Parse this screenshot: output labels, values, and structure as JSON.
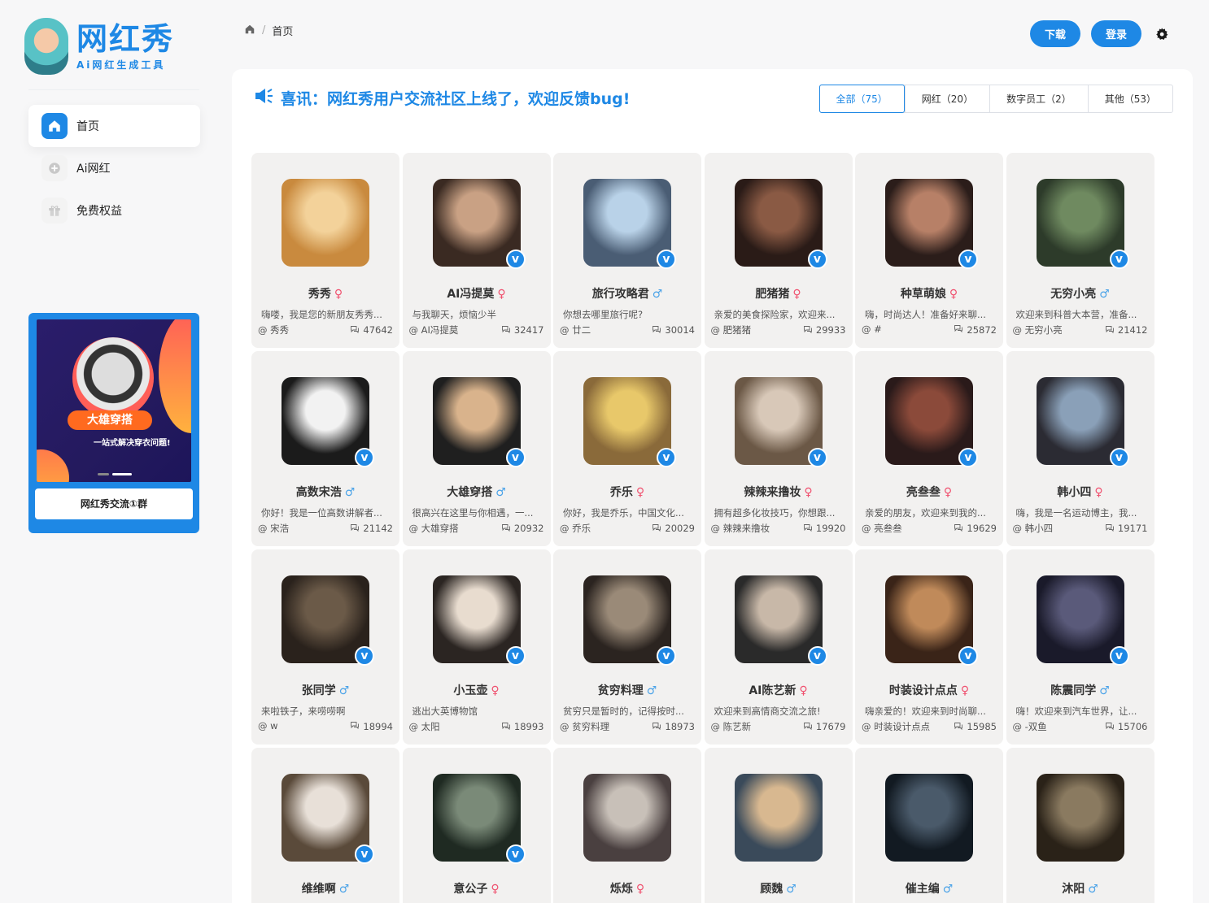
{
  "brand": {
    "title": "网红秀",
    "subtitle": "Ai网红生成工具"
  },
  "nav": [
    {
      "label": "首页",
      "icon": "home-icon",
      "active": true
    },
    {
      "label": "Ai网红",
      "icon": "plus-circle-icon",
      "active": false
    },
    {
      "label": "免费权益",
      "icon": "gift-icon",
      "active": false
    }
  ],
  "promo": {
    "tag": "大雄穿搭",
    "slogan": "一站式解决穿衣问题!",
    "button": "网红秀交流①群"
  },
  "breadcrumb": {
    "home": "首页"
  },
  "actions": {
    "download": "下载",
    "login": "登录"
  },
  "notice": "喜讯：网红秀用户交流社区上线了，欢迎反馈bug!",
  "filters": [
    {
      "label": "全部（75）",
      "active": true
    },
    {
      "label": "网红（20）",
      "active": false
    },
    {
      "label": "数字员工（2）",
      "active": false
    },
    {
      "label": "其他（53）",
      "active": false
    }
  ],
  "colors": {
    "accent": "#1e88e5",
    "female": "#f0506e",
    "male": "#4ba3e8",
    "card": "#f2f1f0"
  },
  "cards": [
    {
      "name": "秀秀",
      "gender": "f",
      "verified": false,
      "desc": "嗨喽，我是您的新朋友秀秀...",
      "author": "秀秀",
      "count": "47642",
      "g": [
        "#f3d29a",
        "#c98a3e"
      ]
    },
    {
      "name": "AI冯提莫",
      "gender": "f",
      "verified": true,
      "desc": "与我聊天，烦恼少半",
      "author": "AI冯提莫",
      "count": "32417",
      "g": [
        "#c9a184",
        "#3a2a22"
      ]
    },
    {
      "name": "旅行攻略君",
      "gender": "m",
      "verified": true,
      "desc": "你想去哪里旅行呢?",
      "author": "廿二",
      "count": "30014",
      "g": [
        "#b9d2e8",
        "#4a5d74"
      ]
    },
    {
      "name": "肥猪猪",
      "gender": "f",
      "verified": true,
      "desc": "亲爱的美食探险家，欢迎来...",
      "author": "肥猪猪",
      "count": "29933",
      "g": [
        "#8a5a44",
        "#2a1b17"
      ]
    },
    {
      "name": "种草萌娘",
      "gender": "f",
      "verified": true,
      "desc": "嗨，时尚达人！准备好来聊...",
      "author": "#",
      "count": "25872",
      "g": [
        "#b78067",
        "#2b1d1a"
      ]
    },
    {
      "name": "无穷小亮",
      "gender": "m",
      "verified": true,
      "desc": "欢迎来到科普大本营，准备...",
      "author": "无穷小亮",
      "count": "21412",
      "g": [
        "#6f8a60",
        "#2d3b2a"
      ]
    },
    {
      "name": "高数宋浩",
      "gender": "m",
      "verified": true,
      "desc": "你好！我是一位高数讲解者...",
      "author": "宋浩",
      "count": "21142",
      "g": [
        "#f2f2f2",
        "#1b1b1b"
      ]
    },
    {
      "name": "大雄穿搭",
      "gender": "m",
      "verified": true,
      "desc": "很高兴在这里与你相遇，一...",
      "author": "大雄穿搭",
      "count": "20932",
      "g": [
        "#d9b38c",
        "#1f1f1f"
      ]
    },
    {
      "name": "乔乐",
      "gender": "f",
      "verified": true,
      "desc": "你好，我是乔乐，中国文化...",
      "author": "乔乐",
      "count": "20029",
      "g": [
        "#e8c86a",
        "#8a6a3a"
      ]
    },
    {
      "name": "辣辣来撸妆",
      "gender": "f",
      "verified": true,
      "desc": "拥有超多化妆技巧，你想跟...",
      "author": "辣辣来撸妆",
      "count": "19920",
      "g": [
        "#d8c8b8",
        "#6b5846"
      ]
    },
    {
      "name": "亮叁叁",
      "gender": "f",
      "verified": true,
      "desc": "亲爱的朋友，欢迎来到我的...",
      "author": "亮叁叁",
      "count": "19629",
      "g": [
        "#8b4a3a",
        "#2a1a1a"
      ]
    },
    {
      "name": "韩小四",
      "gender": "f",
      "verified": true,
      "desc": "嗨，我是一名运动博主，我...",
      "author": "韩小四",
      "count": "19171",
      "g": [
        "#8aa0b8",
        "#2b2b33"
      ]
    },
    {
      "name": "张同学",
      "gender": "m",
      "verified": true,
      "desc": "来啦铁子，来唠唠啊",
      "author": "w",
      "count": "18994",
      "g": [
        "#6b5a48",
        "#2a221c"
      ]
    },
    {
      "name": "小玉壶",
      "gender": "f",
      "verified": true,
      "desc": "逃出大英博物馆",
      "author": "太阳",
      "count": "18993",
      "g": [
        "#e8dccf",
        "#2b2522"
      ]
    },
    {
      "name": "贫穷料理",
      "gender": "m",
      "verified": true,
      "desc": "贫穷只是暂时的，记得按时...",
      "author": "贫穷料理",
      "count": "18973",
      "g": [
        "#9a8a78",
        "#2b2420"
      ]
    },
    {
      "name": "AI陈艺新",
      "gender": "f",
      "verified": true,
      "desc": "欢迎来到高情商交流之旅!",
      "author": "陈艺新",
      "count": "17679",
      "g": [
        "#c8b8a8",
        "#2a2a2a"
      ]
    },
    {
      "name": "时装设计点点",
      "gender": "f",
      "verified": true,
      "desc": "嗨亲爱的！欢迎来到时尚聊...",
      "author": "时装设计点点",
      "count": "15985",
      "g": [
        "#c08a5a",
        "#3a2418"
      ]
    },
    {
      "name": "陈震同学",
      "gender": "m",
      "verified": true,
      "desc": "嗨！欢迎来到汽车世界，让...",
      "author": "-双鱼",
      "count": "15706",
      "g": [
        "#5a5a7a",
        "#1a1a2a"
      ]
    },
    {
      "name": "维维啊",
      "gender": "m",
      "verified": true,
      "desc": "",
      "author": "",
      "count": "",
      "g": [
        "#e8e0d8",
        "#5a4a3a"
      ]
    },
    {
      "name": "意公子",
      "gender": "f",
      "verified": true,
      "desc": "",
      "author": "",
      "count": "",
      "g": [
        "#7a8a78",
        "#1f2a22"
      ]
    },
    {
      "name": "烁烁",
      "gender": "f",
      "verified": false,
      "desc": "",
      "author": "",
      "count": "",
      "g": [
        "#c8c0b8",
        "#4a4040"
      ]
    },
    {
      "name": "顾魏",
      "gender": "m",
      "verified": false,
      "desc": "",
      "author": "",
      "count": "",
      "g": [
        "#d8b890",
        "#3a4a5a"
      ]
    },
    {
      "name": "催主编",
      "gender": "m",
      "verified": false,
      "desc": "",
      "author": "",
      "count": "",
      "g": [
        "#4a5a6a",
        "#121a22"
      ]
    },
    {
      "name": "沐阳",
      "gender": "m",
      "verified": false,
      "desc": "",
      "author": "",
      "count": "",
      "g": [
        "#8a7a60",
        "#2a2218"
      ]
    }
  ]
}
